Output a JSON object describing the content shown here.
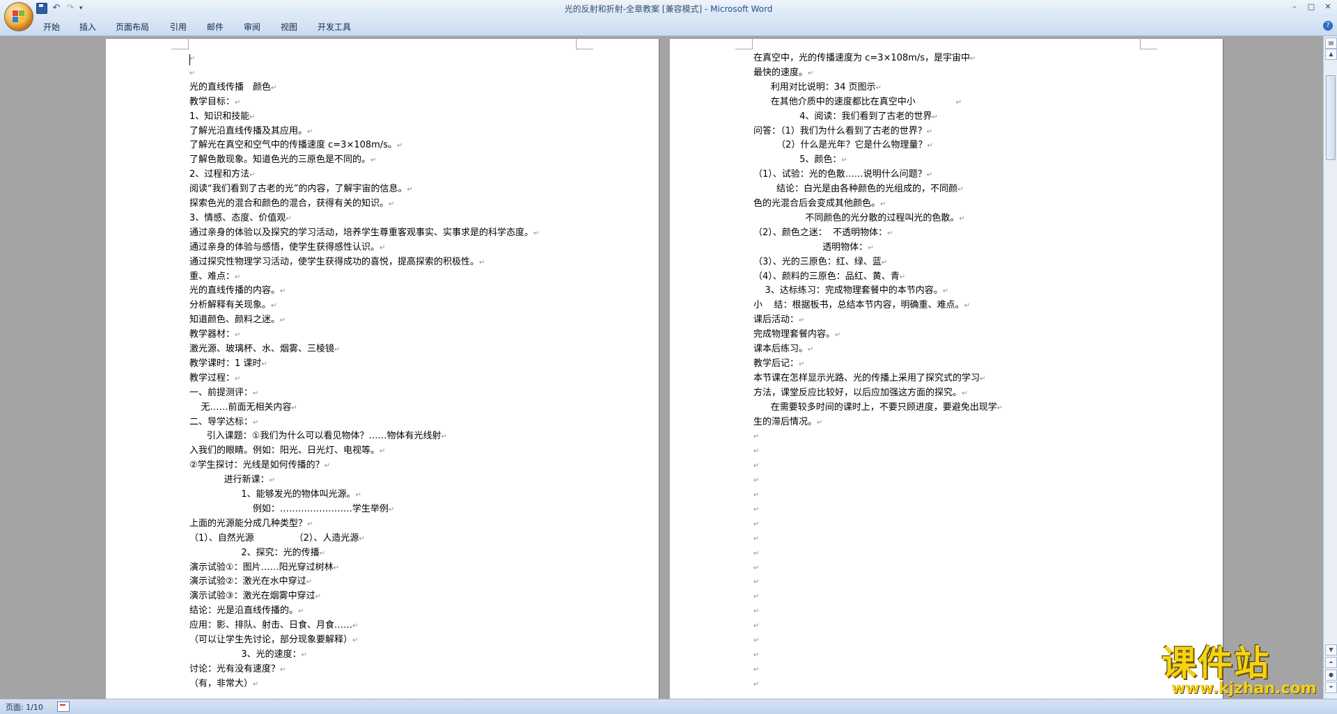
{
  "window": {
    "title": "光的反射和折射-全章教案 [兼容模式] - ",
    "app_name": "Microsoft Word",
    "controls": [
      "–",
      "□",
      "✕"
    ]
  },
  "ribbon": {
    "tabs": [
      "开始",
      "插入",
      "页面布局",
      "引用",
      "邮件",
      "审阅",
      "视图",
      "开发工具"
    ],
    "help": "?"
  },
  "quick_access": {
    "icons": [
      "save-icon",
      "undo-icon",
      "redo-icon"
    ],
    "undo_glyph": "↶",
    "redo_glyph": "↷",
    "more": "▾"
  },
  "status_bar": {
    "page": "页面: 1/10"
  },
  "paragraph_mark": "↵",
  "page_left": [
    {
      "text": "",
      "mark": true
    },
    {
      "text": "",
      "mark": true
    },
    {
      "text": "光的直线传播　颜色",
      "mark": true
    },
    {
      "text": "教学目标：",
      "mark": true
    },
    {
      "text": "1、知识和技能",
      "mark": true
    },
    {
      "text": "了解光沿直线传播及其应用。",
      "mark": true
    },
    {
      "text": "了解光在真空和空气中的传播速度 c=3×108m/s。",
      "mark": true
    },
    {
      "text": "了解色散现象。知道色光的三原色是不同的。",
      "mark": true
    },
    {
      "text": "2、过程和方法",
      "mark": true
    },
    {
      "text": "阅读“我们看到了古老的光”的内容，了解宇宙的信息。",
      "mark": true
    },
    {
      "text": "探索色光的混合和颜色的混合，获得有关的知识。",
      "mark": true
    },
    {
      "text": "3、情感、态度、价值观",
      "mark": true
    },
    {
      "text": "通过亲身的体验以及探究的学习活动，培养学生尊重客观事实、实事求是的科学态度。",
      "mark": true
    },
    {
      "text": "通过亲身的体验与感悟，使学生获得感性认识。",
      "mark": true
    },
    {
      "text": "通过探究性物理学习活动，使学生获得成功的喜悦，提高探索的积极性。",
      "mark": true
    },
    {
      "text": "重、难点：",
      "mark": true
    },
    {
      "text": "光的直线传播的内容。",
      "mark": true
    },
    {
      "text": "分析解释有关现象。",
      "mark": true
    },
    {
      "text": "知道颜色、颜料之迷。",
      "mark": true
    },
    {
      "text": "教学器材：",
      "mark": true
    },
    {
      "text": "激光源、玻璃杯、水、烟雾、三棱镜",
      "mark": true
    },
    {
      "text": "教学课时：1 课时",
      "mark": true
    },
    {
      "text": "教学过程：",
      "mark": true
    },
    {
      "text": "一、前提测评：",
      "mark": true
    },
    {
      "text": "    无……前面无相关内容",
      "mark": true
    },
    {
      "text": "二、导学达标：",
      "mark": true
    },
    {
      "text": "      引入课题：①我们为什么可以看见物体？……物体有光线射",
      "mark": true
    },
    {
      "text": "入我们的眼睛。例如：阳光、日光灯、电视等。",
      "mark": true
    },
    {
      "text": "②学生探讨：光线是如何传播的？",
      "mark": true
    },
    {
      "text": "            进行新课：",
      "mark": true
    },
    {
      "text": "                  1、能够发光的物体叫光源。",
      "mark": true
    },
    {
      "text": "                      例如：……………………学生举例",
      "mark": true
    },
    {
      "text": "上面的光源能分成几种类型？",
      "mark": true
    },
    {
      "text": "（1）、自然光源              （2）、人造光源",
      "mark": true
    },
    {
      "text": "                  2、探究：光的传播",
      "mark": true
    },
    {
      "text": "演示试验①：图片……阳光穿过树林",
      "mark": true
    },
    {
      "text": "演示试验②：激光在水中穿过",
      "mark": true
    },
    {
      "text": "演示试验③：激光在烟雾中穿过",
      "mark": true
    },
    {
      "text": "结论：光是沿直线传播的。",
      "mark": true
    },
    {
      "text": "应用：影、排队、射击、日食、月食……",
      "mark": true
    },
    {
      "text": "（可以让学生先讨论，部分现象要解释）",
      "mark": true
    },
    {
      "text": "                  3、光的速度：",
      "mark": true
    },
    {
      "text": "讨论：光有没有速度？",
      "mark": true
    },
    {
      "text": "（有，非常大）",
      "mark": true
    }
  ],
  "page_right": [
    {
      "text": "在真空中，光的传播速度为 c=3×108m/s，是宇宙中",
      "mark": true
    },
    {
      "text": "最快的速度。",
      "mark": true
    },
    {
      "text": "      利用对比说明：34 页图示",
      "mark": true
    },
    {
      "text": "      在其他介质中的速度都比在真空中小              ",
      "mark": true
    },
    {
      "text": "                4、阅读：我们看到了古老的世界",
      "mark": true
    },
    {
      "text": "问答：（1）我们为什么看到了古老的世界？",
      "mark": true
    },
    {
      "text": "        （2）什么是光年？它是什么物理量？",
      "mark": true
    },
    {
      "text": "                5、颜色：",
      "mark": true
    },
    {
      "text": "（1）、试验：光的色散……说明什么问题？",
      "mark": true
    },
    {
      "text": "        结论：白光是由各种颜色的光组成的，不同颜",
      "mark": true
    },
    {
      "text": "色的光混合后会变成其他颜色。",
      "mark": true
    },
    {
      "text": "                  不同颜色的光分散的过程叫光的色散。",
      "mark": true
    },
    {
      "text": "（2）、颜色之迷：  不透明物体：",
      "mark": true
    },
    {
      "text": "                        透明物体：",
      "mark": true
    },
    {
      "text": "（3）、光的三原色：红、绿、蓝",
      "mark": true
    },
    {
      "text": "（4）、颜料的三原色：品红、黄、青",
      "mark": true
    },
    {
      "text": "    3、达标练习：完成物理套餐中的本节内容。",
      "mark": true
    },
    {
      "text": "小    结：根据板书，总结本节内容，明确重、难点。",
      "mark": true
    },
    {
      "text": "课后活动：",
      "mark": true
    },
    {
      "text": "完成物理套餐内容。",
      "mark": true
    },
    {
      "text": "课本后练习。",
      "mark": true
    },
    {
      "text": "教学后记：",
      "mark": true
    },
    {
      "text": "本节课在怎样显示光路、光的传播上采用了探究式的学习",
      "mark": true
    },
    {
      "text": "方法，课堂反应比较好，以后应加强这方面的探究。",
      "mark": true
    },
    {
      "text": "      在需要较多时间的课时上，不要只顾进度，要避免出现学",
      "mark": true
    },
    {
      "text": "生的滞后情况。",
      "mark": true
    },
    {
      "text": "",
      "mark": true
    },
    {
      "text": "",
      "mark": true
    },
    {
      "text": "",
      "mark": true
    },
    {
      "text": "",
      "mark": true
    },
    {
      "text": "",
      "mark": true
    },
    {
      "text": "",
      "mark": true
    },
    {
      "text": "",
      "mark": true
    },
    {
      "text": "",
      "mark": true
    },
    {
      "text": "",
      "mark": true
    },
    {
      "text": "",
      "mark": true
    },
    {
      "text": "",
      "mark": true
    },
    {
      "text": "",
      "mark": true
    },
    {
      "text": "",
      "mark": true
    },
    {
      "text": "",
      "mark": true
    },
    {
      "text": "",
      "mark": true
    },
    {
      "text": "",
      "mark": true
    },
    {
      "text": "",
      "mark": true
    },
    {
      "text": "",
      "mark": true
    }
  ],
  "watermark": {
    "logo": "课件站",
    "url": "www.kjzhan.com"
  },
  "colors": {
    "app_name": "#2a4f8f",
    "watermark": "#f6d312",
    "workspace": "#a4a4a4"
  }
}
